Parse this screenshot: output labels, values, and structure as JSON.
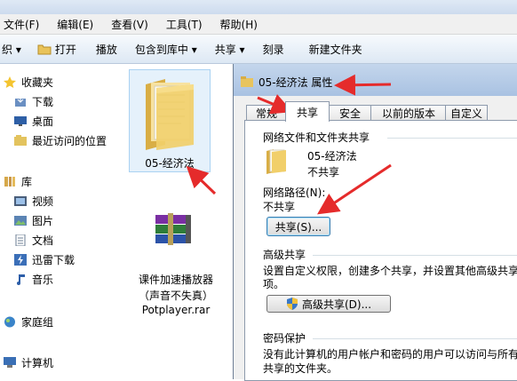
{
  "menubar": {
    "items": [
      "文件(F)",
      "编辑(E)",
      "查看(V)",
      "工具(T)",
      "帮助(H)"
    ]
  },
  "toolbar": {
    "organize": "织 ▾",
    "open": "打开",
    "play": "播放",
    "include": "包含到库中 ▾",
    "share": "共享 ▾",
    "burn": "刻录",
    "new_folder": "新建文件夹"
  },
  "sidebar": {
    "favorites": "收藏夹",
    "downloads": "下载",
    "desktop": "桌面",
    "recent": "最近访问的位置",
    "libraries": "库",
    "videos": "视频",
    "pictures": "图片",
    "documents": "文档",
    "thunder": "迅雷下载",
    "music": "音乐",
    "homegroup": "家庭组",
    "computer": "计算机"
  },
  "files": {
    "folder_name": "05-经济法",
    "rar_line1": "课件加速播放器",
    "rar_line2": "（声音不失真）",
    "rar_line3": "Potplayer.rar"
  },
  "dialog": {
    "title": "05-经济法 属性",
    "tabs": [
      "常规",
      "共享",
      "安全",
      "以前的版本",
      "自定义"
    ],
    "network_group": "网络文件和文件夹共享",
    "folder_name": "05-经济法",
    "folder_status": "不共享",
    "network_path_label": "网络路径(N):",
    "network_path_value": "不共享",
    "share_button": "共享(S)...",
    "advanced_group": "高级共享",
    "advanced_desc_1": "设置自定义权限，创建多个共享，并设置其他高级共享",
    "advanced_desc_2": "项。",
    "advanced_button": "高级共享(D)...",
    "password_group": "密码保护",
    "password_desc_1": "没有此计算机的用户帐户和密码的用户可以访问与所有",
    "password_desc_2": "共享的文件夹。"
  },
  "colors": {
    "annotation_arrow": "#e52b2b",
    "folder_yellow": "#f1cf6a",
    "dialog_bg": "#f0f0f0"
  }
}
